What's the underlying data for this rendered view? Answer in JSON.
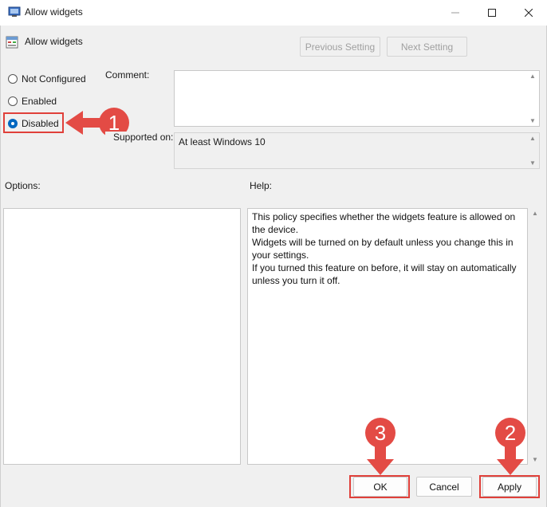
{
  "window": {
    "title": "Allow widgets",
    "minimize_icon": "minimize-icon",
    "maximize_icon": "maximize-icon",
    "close_icon": "close-icon"
  },
  "header": {
    "policy_name": "Allow widgets",
    "prev_label": "Previous Setting",
    "next_label": "Next Setting"
  },
  "state_options": [
    {
      "label": "Not Configured",
      "checked": false
    },
    {
      "label": "Enabled",
      "checked": false
    },
    {
      "label": "Disabled",
      "checked": true
    }
  ],
  "comment": {
    "label": "Comment:",
    "value": ""
  },
  "supported": {
    "label": "Supported on:",
    "value": "At least Windows 10"
  },
  "options": {
    "label": "Options:"
  },
  "help": {
    "label": "Help:",
    "lines": [
      "This policy specifies whether the widgets feature is allowed on",
      "the device.",
      "Widgets will be turned on by default unless you change this in",
      "your settings.",
      "If you turned this feature on before, it will stay on automatically",
      "unless you turn it off."
    ]
  },
  "footer": {
    "ok_label": "OK",
    "cancel_label": "Cancel",
    "apply_label": "Apply"
  },
  "annotations": {
    "step1": "1",
    "step2": "2",
    "step3": "3",
    "accent_color": "#e34b45"
  }
}
